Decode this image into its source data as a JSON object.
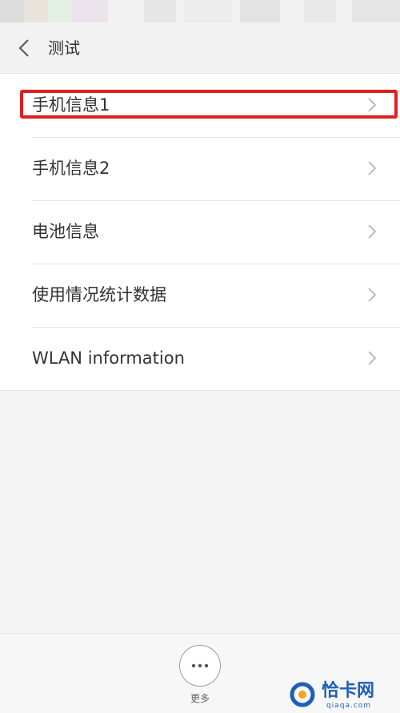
{
  "header": {
    "title": "测试"
  },
  "list": {
    "items": [
      {
        "label": "手机信息1",
        "highlighted": true
      },
      {
        "label": "手机信息2"
      },
      {
        "label": "电池信息"
      },
      {
        "label": "使用情况统计数据"
      },
      {
        "label": "WLAN information"
      }
    ]
  },
  "footer": {
    "more_label": "更多"
  },
  "watermark": {
    "text": "恰卡网",
    "sub": "qiaqa.com"
  },
  "colors": {
    "highlight": "#e01e1e",
    "watermark": "#1e5fb8"
  }
}
